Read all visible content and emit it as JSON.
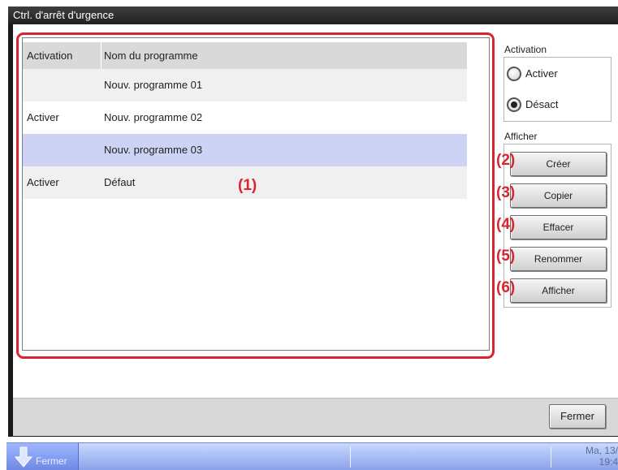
{
  "window": {
    "title": "Ctrl. d'arrêt d'urgence"
  },
  "table": {
    "headers": {
      "activation": "Activation",
      "name": "Nom du programme"
    },
    "rows": [
      {
        "activation": "",
        "name": "Nouv. programme 01"
      },
      {
        "activation": "Activer",
        "name": "Nouv. programme 02"
      },
      {
        "activation": "",
        "name": "Nouv. programme 03"
      },
      {
        "activation": "Activer",
        "name": "Défaut"
      }
    ],
    "selected_index": 2
  },
  "activation_group": {
    "label": "Activation",
    "options": [
      {
        "label": "Activer",
        "selected": false
      },
      {
        "label": "Désact",
        "selected": true
      }
    ]
  },
  "display_group": {
    "label": "Afficher",
    "buttons": {
      "create": "Créer",
      "copy": "Copier",
      "delete": "Effacer",
      "rename": "Renommer",
      "display": "Afficher"
    }
  },
  "callouts": {
    "list": "(1)",
    "create": "(2)",
    "copy": "(3)",
    "delete": "(4)",
    "rename": "(5)",
    "display": "(6)"
  },
  "footer": {
    "close": "Fermer"
  },
  "taskbar": {
    "start_label": "Fermer",
    "clock_line1": "Ma, 13/",
    "clock_line2": "19:4"
  },
  "colors": {
    "callout_red": "#d9252f",
    "selected_row": "#cdd3f5",
    "taskbar": "#8aa2ea"
  }
}
